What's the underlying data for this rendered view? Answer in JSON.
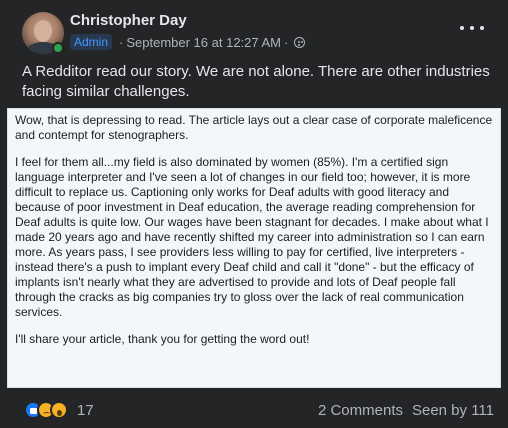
{
  "post": {
    "author": "Christopher Day",
    "role_badge": "Admin",
    "timestamp": "September 16 at 12:27 AM",
    "separator": "·",
    "text": "A Redditor read our story. We are not alone. There are other industries facing similar challenges."
  },
  "shared_comment": {
    "paragraphs": [
      "Wow, that is depressing to read. The article lays out a clear case of corporate maleficence and contempt for stenographers.",
      "I feel for them all...my field is also dominated by women (85%). I'm a certified sign language interpreter and I've seen a lot of changes in our field too; however, it is more difficult to replace us. Captioning only works for Deaf adults with good literacy and because of poor investment in Deaf education, the average reading comprehension for Deaf adults is quite low. Our wages have been stagnant for decades. I make about what I made 20 years ago and have recently shifted my career into administration so I can earn more. As years pass, I see providers less willing to pay for certified, live interpreters - instead there's a push to implant every Deaf child and call it \"done\" - but the efficacy of implants isn't nearly what they are advertised to provide and lots of Deaf people fall through the cracks as big companies try to gloss over the lack of real communication services.",
      "I'll share your article, thank you for getting the word out!"
    ]
  },
  "footer": {
    "reaction_icons": [
      "like-icon",
      "sad-icon",
      "wow-icon"
    ],
    "reaction_count": "17",
    "comments": "2 Comments",
    "seen_by": "Seen by 111"
  },
  "colors": {
    "background": "#242526",
    "accent": "#4599ff",
    "online": "#31a24c"
  }
}
